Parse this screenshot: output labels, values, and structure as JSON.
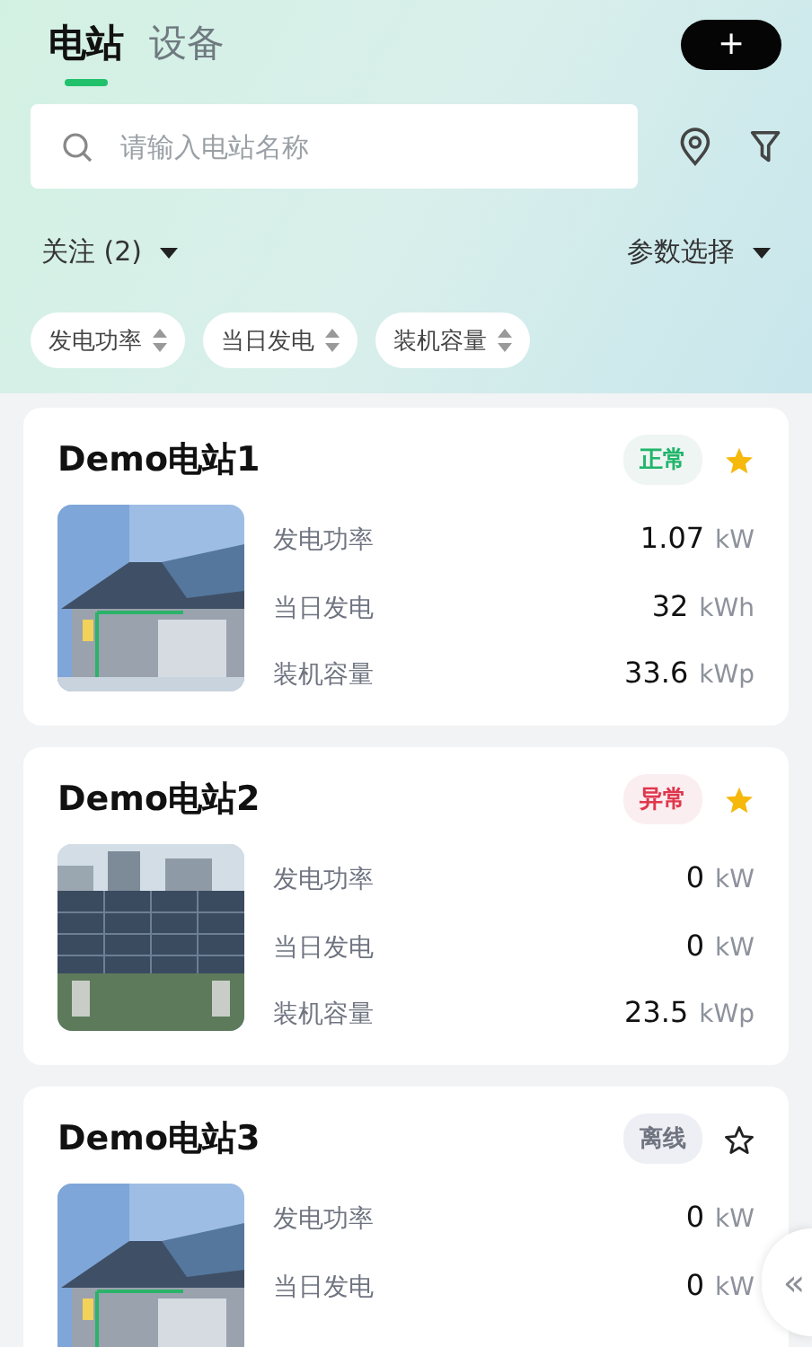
{
  "tabs": [
    {
      "label": "电站",
      "selected": true
    },
    {
      "label": "设备",
      "selected": false
    }
  ],
  "add_button": {
    "label": "+"
  },
  "search": {
    "placeholder": "请输入电站名称"
  },
  "filters": {
    "follow": "关注 (2)",
    "params": "参数选择"
  },
  "sort_chips": [
    {
      "label": "发电功率"
    },
    {
      "label": "当日发电"
    },
    {
      "label": "装机容量"
    }
  ],
  "stations": [
    {
      "name": "Demo电站1",
      "status": {
        "label": "正常",
        "kind": "normal"
      },
      "starred": true,
      "metrics": [
        {
          "label": "发电功率",
          "value": "1.07",
          "unit": "kW"
        },
        {
          "label": "当日发电",
          "value": "32",
          "unit": "kWh"
        },
        {
          "label": "装机容量",
          "value": "33.6",
          "unit": "kWp"
        }
      ]
    },
    {
      "name": "Demo电站2",
      "status": {
        "label": "异常",
        "kind": "fault"
      },
      "starred": true,
      "metrics": [
        {
          "label": "发电功率",
          "value": "0",
          "unit": "kW"
        },
        {
          "label": "当日发电",
          "value": "0",
          "unit": "kW"
        },
        {
          "label": "装机容量",
          "value": "23.5",
          "unit": "kWp"
        }
      ]
    },
    {
      "name": "Demo电站3",
      "status": {
        "label": "离线",
        "kind": "offline"
      },
      "starred": false,
      "metrics": [
        {
          "label": "发电功率",
          "value": "0",
          "unit": "kW"
        },
        {
          "label": "当日发电",
          "value": "0",
          "unit": "kW"
        }
      ]
    }
  ],
  "collapse_handle": {
    "symbol": "«"
  }
}
